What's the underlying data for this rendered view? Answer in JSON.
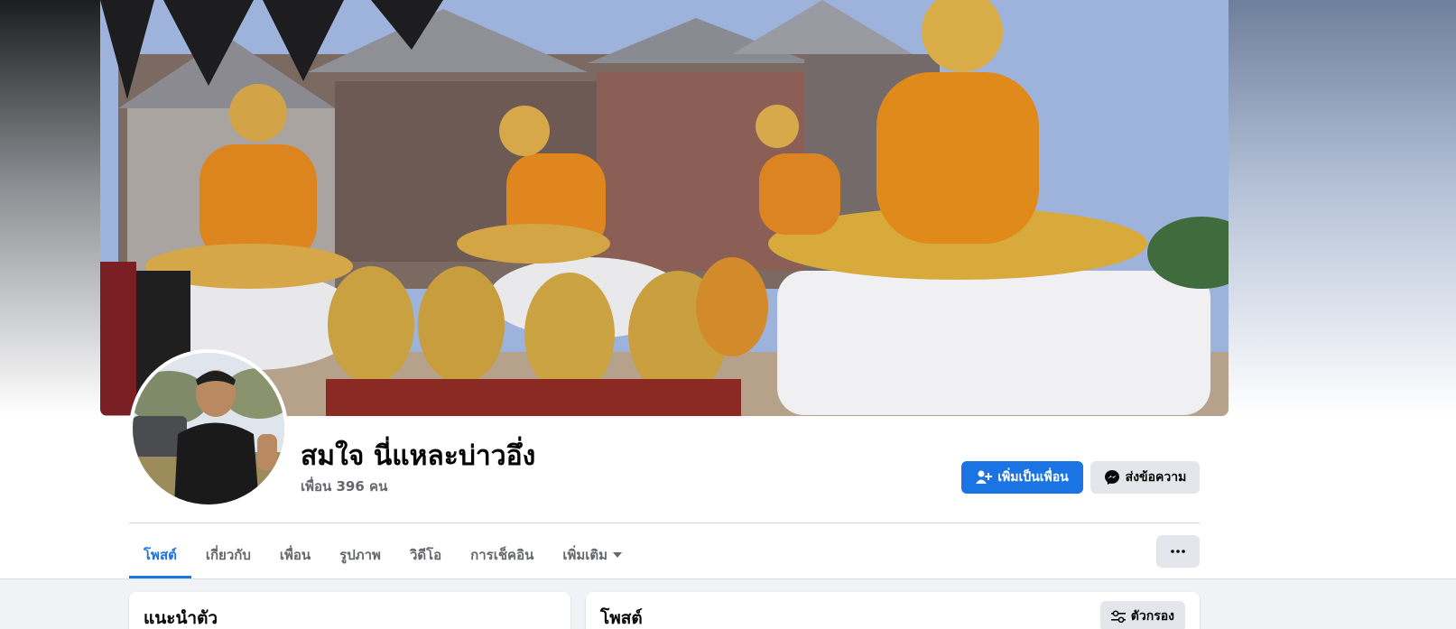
{
  "profile": {
    "name": "สมใจ นี่แหละบ่าวอึ่ง",
    "friends_count": "เพื่อน 396 คน"
  },
  "actions": {
    "add_friend_label": "เพิ่มเป็นเพื่อน",
    "message_label": "ส่งข้อความ"
  },
  "tabs": [
    {
      "label": "โพสต์",
      "active": true
    },
    {
      "label": "เกี่ยวกับ",
      "active": false
    },
    {
      "label": "เพื่อน",
      "active": false
    },
    {
      "label": "รูปภาพ",
      "active": false
    },
    {
      "label": "วิดีโอ",
      "active": false
    },
    {
      "label": "การเช็คอิน",
      "active": false
    },
    {
      "label": "เพิ่มเติม",
      "active": false
    }
  ],
  "intro": {
    "title": "แนะนำตัว"
  },
  "posts": {
    "title": "โพสต์",
    "filter_label": "ตัวกรอง"
  },
  "colors": {
    "accent": "#1b74e4",
    "secondary_button": "#e4e6eb",
    "muted_text": "#65676b"
  },
  "icons": {
    "add_friend": "person-plus-icon",
    "message": "messenger-icon",
    "more_tab": "caret-down-icon",
    "more_menu": "ellipsis-icon",
    "filter": "sliders-icon"
  }
}
